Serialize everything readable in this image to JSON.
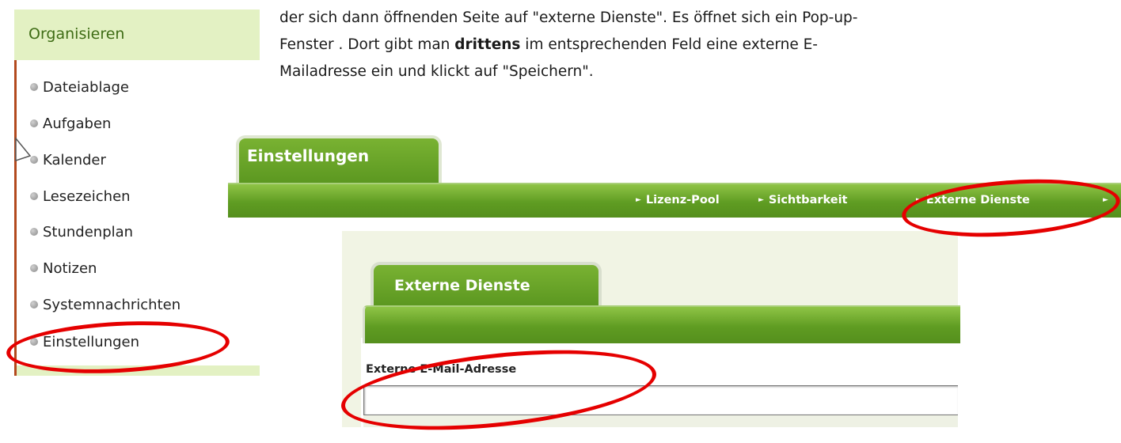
{
  "sidebar": {
    "header": "Organisieren",
    "items": [
      {
        "label": "Dateiablage"
      },
      {
        "label": "Aufgaben"
      },
      {
        "label": "Kalender"
      },
      {
        "label": "Lesezeichen"
      },
      {
        "label": "Stundenplan"
      },
      {
        "label": "Notizen"
      },
      {
        "label": "Systemnachrichten"
      },
      {
        "label": "Einstellungen"
      }
    ]
  },
  "paragraph": {
    "line1": "der sich dann öffnenden Seite auf \"externe Dienste\". Es öffnet sich ein Pop-up-",
    "line2_pre": "Fenster . Dort gibt man ",
    "line2_bold": "drittens",
    "line2_post": " im entsprechenden Feld eine externe E-",
    "line3": "Mailadresse ein und klickt auf \"Speichern\"."
  },
  "settings": {
    "tab_label": "Einstellungen",
    "menu": [
      {
        "label": "Lizenz-Pool"
      },
      {
        "label": "Sichtbarkeit"
      },
      {
        "label": "Externe Dienste"
      }
    ],
    "menu_arrow": "►"
  },
  "popup": {
    "tab_label": "Externe Dienste",
    "field_label": "Externe E-Mail-Adresse",
    "field_value": ""
  },
  "colors": {
    "tab_green": "#6aa62a",
    "sidebar_header_bg": "#e3f1c3",
    "annotation_red": "#e50000"
  }
}
